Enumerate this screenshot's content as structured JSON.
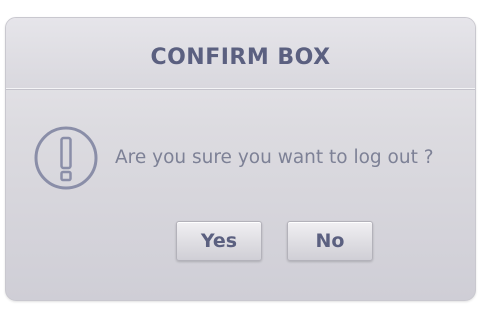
{
  "dialog": {
    "title": "CONFIRM BOX",
    "message": "Are you sure you want to log out ?",
    "icon": "exclamation-circle-icon",
    "buttons": {
      "yes": "Yes",
      "no": "No"
    },
    "colors": {
      "title": "#5b6080",
      "message": "#7d8196",
      "icon": "#8a8ea8",
      "background": "#dcdbe0"
    }
  }
}
